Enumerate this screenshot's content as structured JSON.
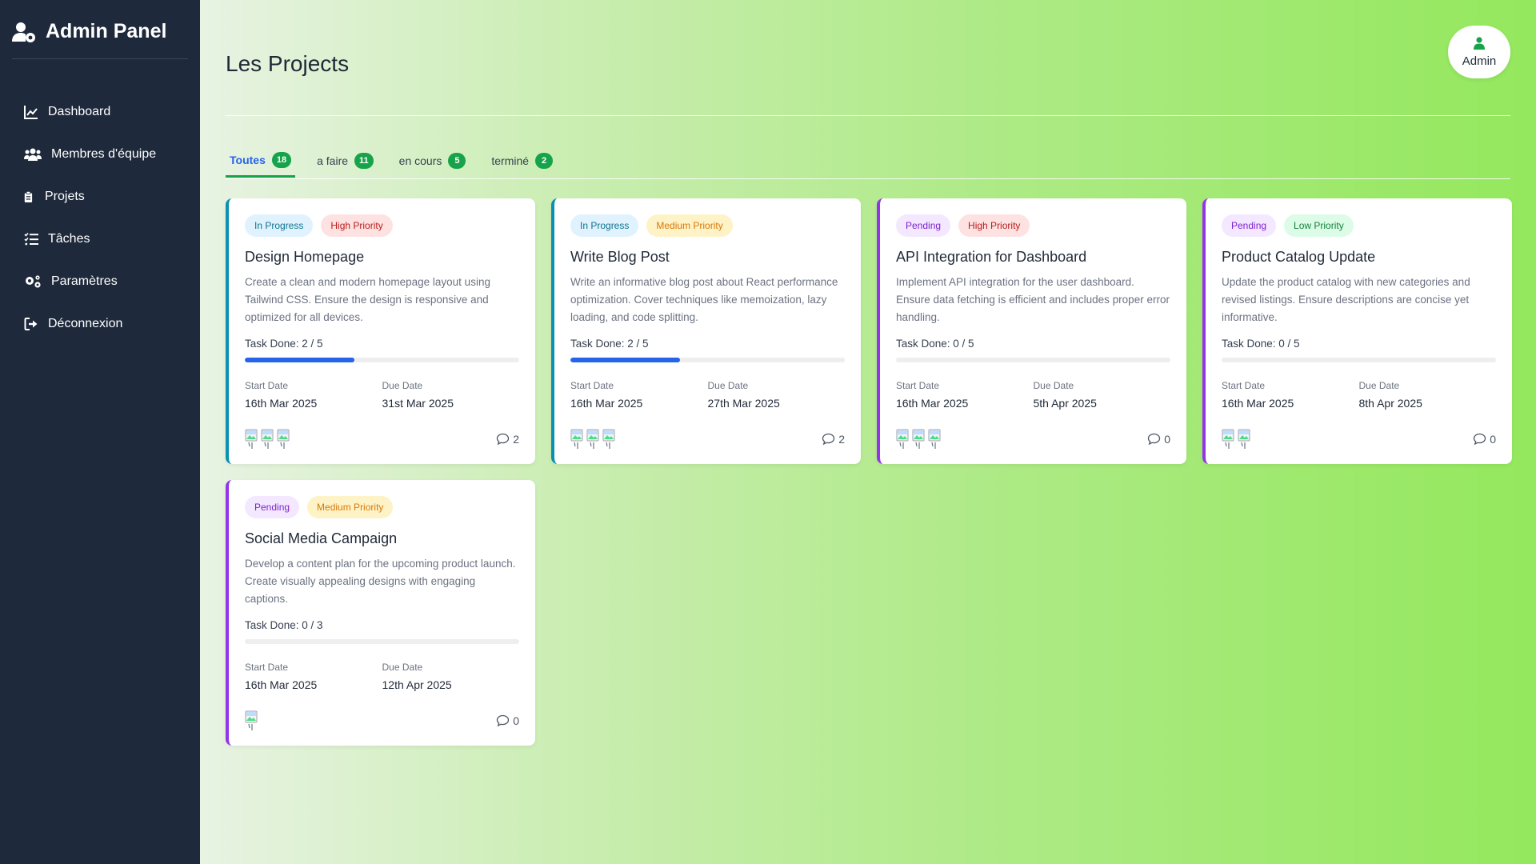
{
  "app": {
    "title": "Admin Panel"
  },
  "sidebar": {
    "items": [
      {
        "label": "Dashboard",
        "icon": "chart-line-icon"
      },
      {
        "label": "Membres d'équipe",
        "icon": "users-icon"
      },
      {
        "label": "Projets",
        "icon": "clipboard-icon"
      },
      {
        "label": "Tâches",
        "icon": "task-list-icon"
      },
      {
        "label": "Paramètres",
        "icon": "gears-icon"
      },
      {
        "label": "Déconnexion",
        "icon": "logout-icon"
      }
    ]
  },
  "header": {
    "title": "Les Projects",
    "user_label": "Admin"
  },
  "tabs": [
    {
      "label": "Toutes",
      "count": "18",
      "active": true
    },
    {
      "label": "a faire",
      "count": "11",
      "active": false
    },
    {
      "label": "en cours",
      "count": "5",
      "active": false
    },
    {
      "label": "terminé",
      "count": "2",
      "active": false
    }
  ],
  "colors": {
    "sidebar_bg": "#1e293b",
    "accent_blue": "#2563eb",
    "tab_count_green": "#16a34a",
    "in_progress_border": "#0891b2",
    "pending_border": "#9333ea"
  },
  "projects": [
    {
      "status": "In Progress",
      "priority": "High Priority",
      "title": "Design Homepage",
      "description": "Create a clean and modern homepage layout using Tailwind CSS. Ensure the design is responsive and optimized for all devices.",
      "task_done": "Task Done: 2 / 5",
      "progress": 0.4,
      "start_label": "Start Date",
      "start_date": "16th Mar 2025",
      "due_label": "Due Date",
      "due_date": "31st Mar 2025",
      "avatar_count": 3,
      "comments": "2"
    },
    {
      "status": "In Progress",
      "priority": "Medium Priority",
      "title": "Write Blog Post",
      "description": "Write an informative blog post about React performance optimization. Cover techniques like memoization, lazy loading, and code splitting.",
      "task_done": "Task Done: 2 / 5",
      "progress": 0.4,
      "start_label": "Start Date",
      "start_date": "16th Mar 2025",
      "due_label": "Due Date",
      "due_date": "27th Mar 2025",
      "avatar_count": 3,
      "comments": "2"
    },
    {
      "status": "Pending",
      "priority": "High Priority",
      "title": "API Integration for Dashboard",
      "description": "Implement API integration for the user dashboard. Ensure data fetching is efficient and includes proper error handling.",
      "task_done": "Task Done: 0 / 5",
      "progress": 0,
      "start_label": "Start Date",
      "start_date": "16th Mar 2025",
      "due_label": "Due Date",
      "due_date": "5th Apr 2025",
      "avatar_count": 3,
      "comments": "0"
    },
    {
      "status": "Pending",
      "priority": "Low Priority",
      "title": "Product Catalog Update",
      "description": "Update the product catalog with new categories and revised listings. Ensure descriptions are concise yet informative.",
      "task_done": "Task Done: 0 / 5",
      "progress": 0,
      "start_label": "Start Date",
      "start_date": "16th Mar 2025",
      "due_label": "Due Date",
      "due_date": "8th Apr 2025",
      "avatar_count": 2,
      "comments": "0"
    },
    {
      "status": "Pending",
      "priority": "Medium Priority",
      "title": "Social Media Campaign",
      "description": "Develop a content plan for the upcoming product launch. Create visually appealing designs with engaging captions.",
      "task_done": "Task Done: 0 / 3",
      "progress": 0,
      "start_label": "Start Date",
      "start_date": "16th Mar 2025",
      "due_label": "Due Date",
      "due_date": "12th Apr 2025",
      "avatar_count": 1,
      "comments": "0"
    }
  ]
}
